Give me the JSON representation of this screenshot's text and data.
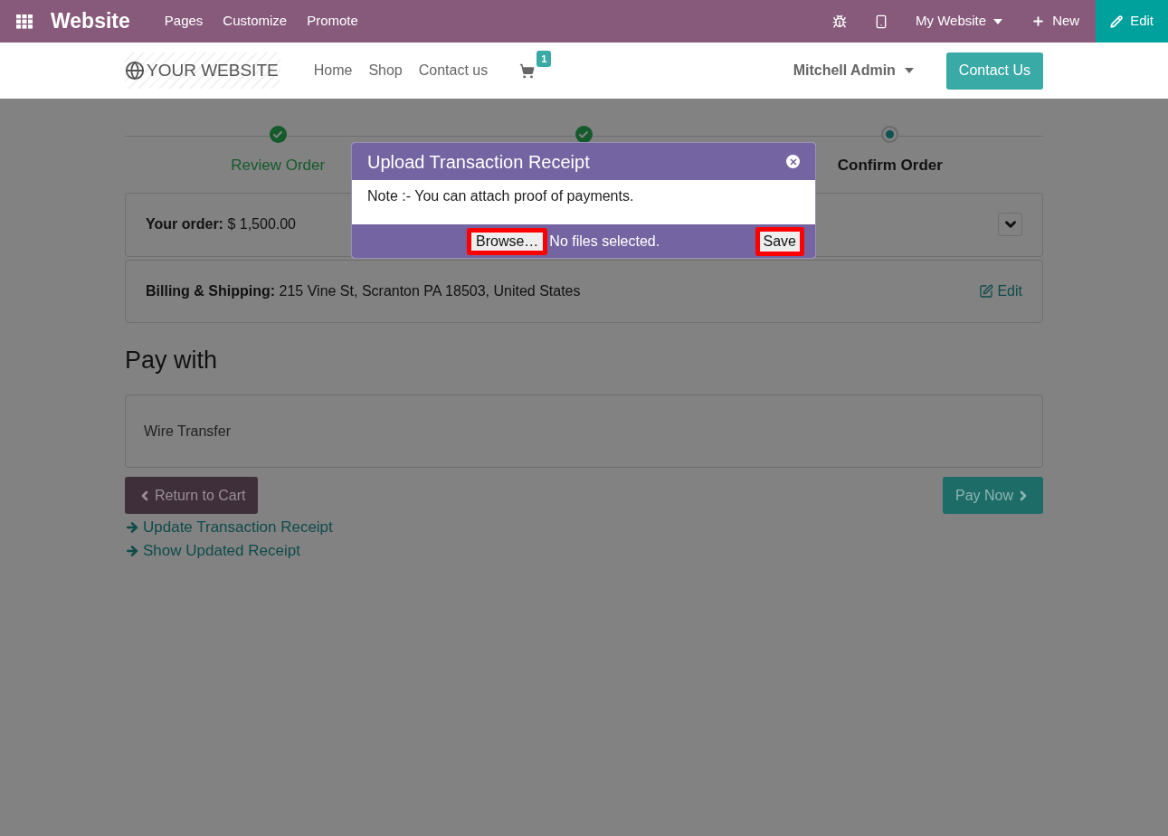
{
  "topbar": {
    "app_title": "Website",
    "menu": [
      "Pages",
      "Customize",
      "Promote"
    ],
    "website_menu": "My Website",
    "new_label": "New",
    "edit_label": "Edit"
  },
  "navbar": {
    "logo": "YOUR WEBSITE",
    "links": [
      "Home",
      "Shop",
      "Contact us"
    ],
    "cart_count": "1",
    "user": "Mitchell Admin",
    "cta": "Contact Us"
  },
  "steps": [
    {
      "label": "Review Order",
      "completed": true
    },
    {
      "completed": true
    },
    {
      "label": "Confirm Order",
      "completed": false
    }
  ],
  "order": {
    "label": "Your order:",
    "amount": "$ 1,500.00"
  },
  "billing": {
    "label": "Billing & Shipping:",
    "address": "215 Vine St, Scranton PA 18503, United States",
    "edit": "Edit"
  },
  "pay_with": {
    "title": "Pay with",
    "methods": [
      "Wire Transfer"
    ]
  },
  "buttons": {
    "back": "Return to Cart",
    "pay": "Pay Now"
  },
  "links": [
    "Update Transaction Receipt",
    "Show Updated Receipt"
  ],
  "modal": {
    "title": "Upload Transaction Receipt",
    "note": "Note :- You can attach proof of payments.",
    "browse": {
      "label": "Browse…",
      "highlighted": true
    },
    "file_status": "No files selected.",
    "save": {
      "label": "Save",
      "highlighted": true
    }
  }
}
